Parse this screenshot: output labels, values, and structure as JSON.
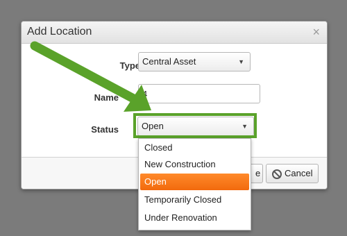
{
  "dialog": {
    "title": "Add Location",
    "close_icon": "×"
  },
  "form": {
    "type": {
      "label": "Type",
      "value": "Central Asset"
    },
    "name": {
      "label": "Name",
      "value": "4"
    },
    "status": {
      "label": "Status",
      "value": "Open"
    }
  },
  "caret_icon": "▼",
  "footer": {
    "save_label_partial": "e",
    "cancel_label": "Cancel"
  },
  "status_options": [
    {
      "label": "Closed",
      "selected": false
    },
    {
      "label": "New Construction",
      "selected": false
    },
    {
      "label": "Open",
      "selected": true
    },
    {
      "label": "Temporarily Closed",
      "selected": false
    },
    {
      "label": "Under Renovation",
      "selected": false
    }
  ],
  "colors": {
    "highlight": "#5aa22a",
    "selected_option": "#f26a0d",
    "overlay": "#7b7b7b"
  }
}
